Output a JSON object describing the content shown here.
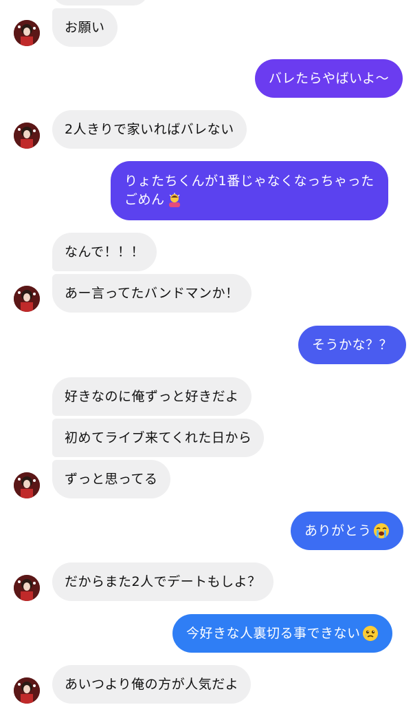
{
  "colors": {
    "incoming_bubble": "#efeff0",
    "outgoing_top": "#6b3cf0",
    "outgoing_mid": "#4a5cf0",
    "outgoing_bottom": "#2f7ef5"
  },
  "messages": [
    {
      "dir": "in",
      "text": "お願い"
    },
    {
      "dir": "out",
      "text": "バレたらやばいよ〜"
    },
    {
      "dir": "in",
      "text": "2人きりで家いればバレない"
    },
    {
      "dir": "out",
      "line1": "りょたちくんが1番じゃなくなっちゃった",
      "line2": "ごめん",
      "emoji": "bowing-person-emoji"
    },
    {
      "dir": "in",
      "text": "なんで！！！"
    },
    {
      "dir": "in",
      "text": "あー言ってたバンドマンか！"
    },
    {
      "dir": "out",
      "text": "そうかな？？"
    },
    {
      "dir": "in",
      "text": "好きなのに俺ずっと好きだよ"
    },
    {
      "dir": "in",
      "text": "初めてライブ来てくれた日から"
    },
    {
      "dir": "in",
      "text": "ずっと思ってる"
    },
    {
      "dir": "out",
      "text": "ありがとう",
      "emoji": "loudly-crying-face-emoji"
    },
    {
      "dir": "in",
      "text": "だからまた2人でデートもしよ？"
    },
    {
      "dir": "out",
      "text": "今好きな人裏切る事できない",
      "emoji": "face-holding-back-tears-emoji"
    },
    {
      "dir": "in",
      "text": "あいつより俺の方が人気だよ"
    }
  ]
}
